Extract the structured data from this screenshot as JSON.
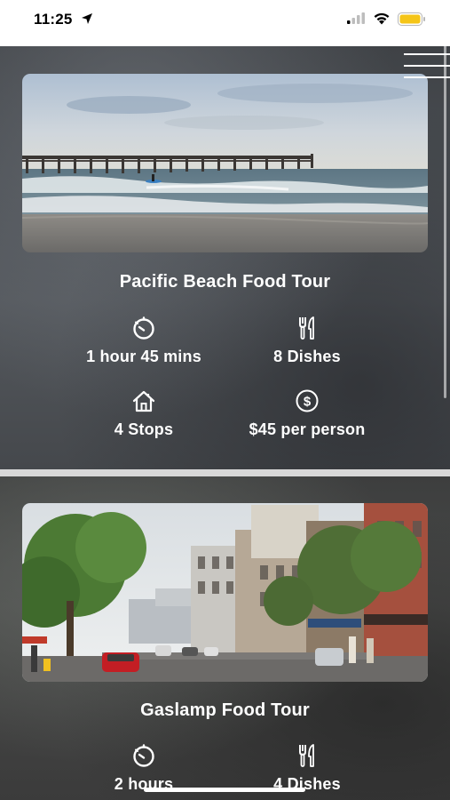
{
  "status_bar": {
    "time": "11:25"
  },
  "tours": [
    {
      "title": "Pacific Beach Food Tour",
      "duration": "1 hour 45 mins",
      "dishes": "8 Dishes",
      "stops": "4 Stops",
      "price": "$45 per person"
    },
    {
      "title": "Gaslamp Food Tour",
      "duration": "2 hours",
      "dishes": "4 Dishes"
    }
  ],
  "icons": {
    "duration": "timer-icon",
    "dishes": "fork-knife-icon",
    "stops": "house-icon",
    "price": "dollar-icon",
    "menu": "hamburger-menu-icon"
  },
  "colors": {
    "text": "#ffffff",
    "battery": "#f5c518",
    "divider": "#d8d8d8"
  }
}
